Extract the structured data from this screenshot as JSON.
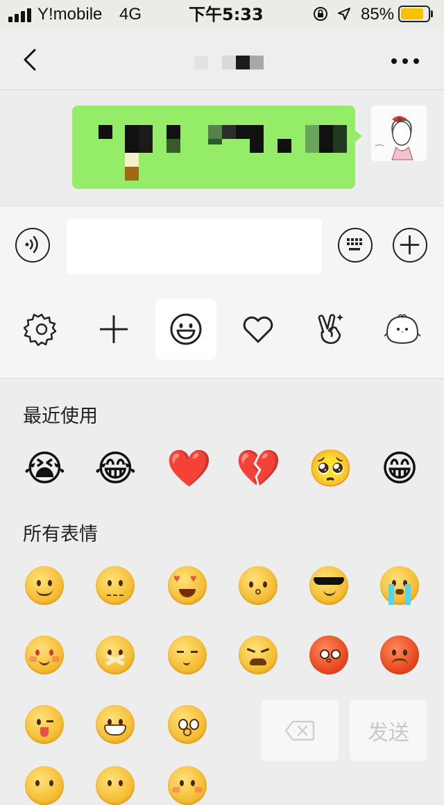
{
  "status_bar": {
    "carrier": "Y!mobile",
    "network": "4G",
    "time": "下午5:33",
    "battery_percent": "85%",
    "battery_level": 0.85
  },
  "nav": {
    "back_icon": "chevron-left-icon",
    "more_icon": "ellipsis-icon"
  },
  "input_bar": {
    "voice_icon": "voice-icon",
    "text_value": "",
    "keyboard_icon": "keyboard-icon",
    "add_icon": "plus-circle-icon"
  },
  "emoji_toolbar": {
    "items": [
      {
        "icon": "gear-icon"
      },
      {
        "icon": "plus-icon"
      },
      {
        "icon": "smiley-icon",
        "selected": true
      },
      {
        "icon": "heart-icon"
      },
      {
        "icon": "victory-hand-icon"
      },
      {
        "icon": "bird-sticker-icon"
      }
    ]
  },
  "emoji_panel": {
    "recent_title": "最近使用",
    "all_title": "所有表情",
    "recent": [
      "😭",
      "😂",
      "❤️",
      "💔",
      "🥺",
      "😁"
    ]
  },
  "actions": {
    "delete_icon": "backspace-icon",
    "send_label": "发送"
  },
  "colors": {
    "bubble": "#95ec69",
    "accent_battery": "#f7c200"
  }
}
